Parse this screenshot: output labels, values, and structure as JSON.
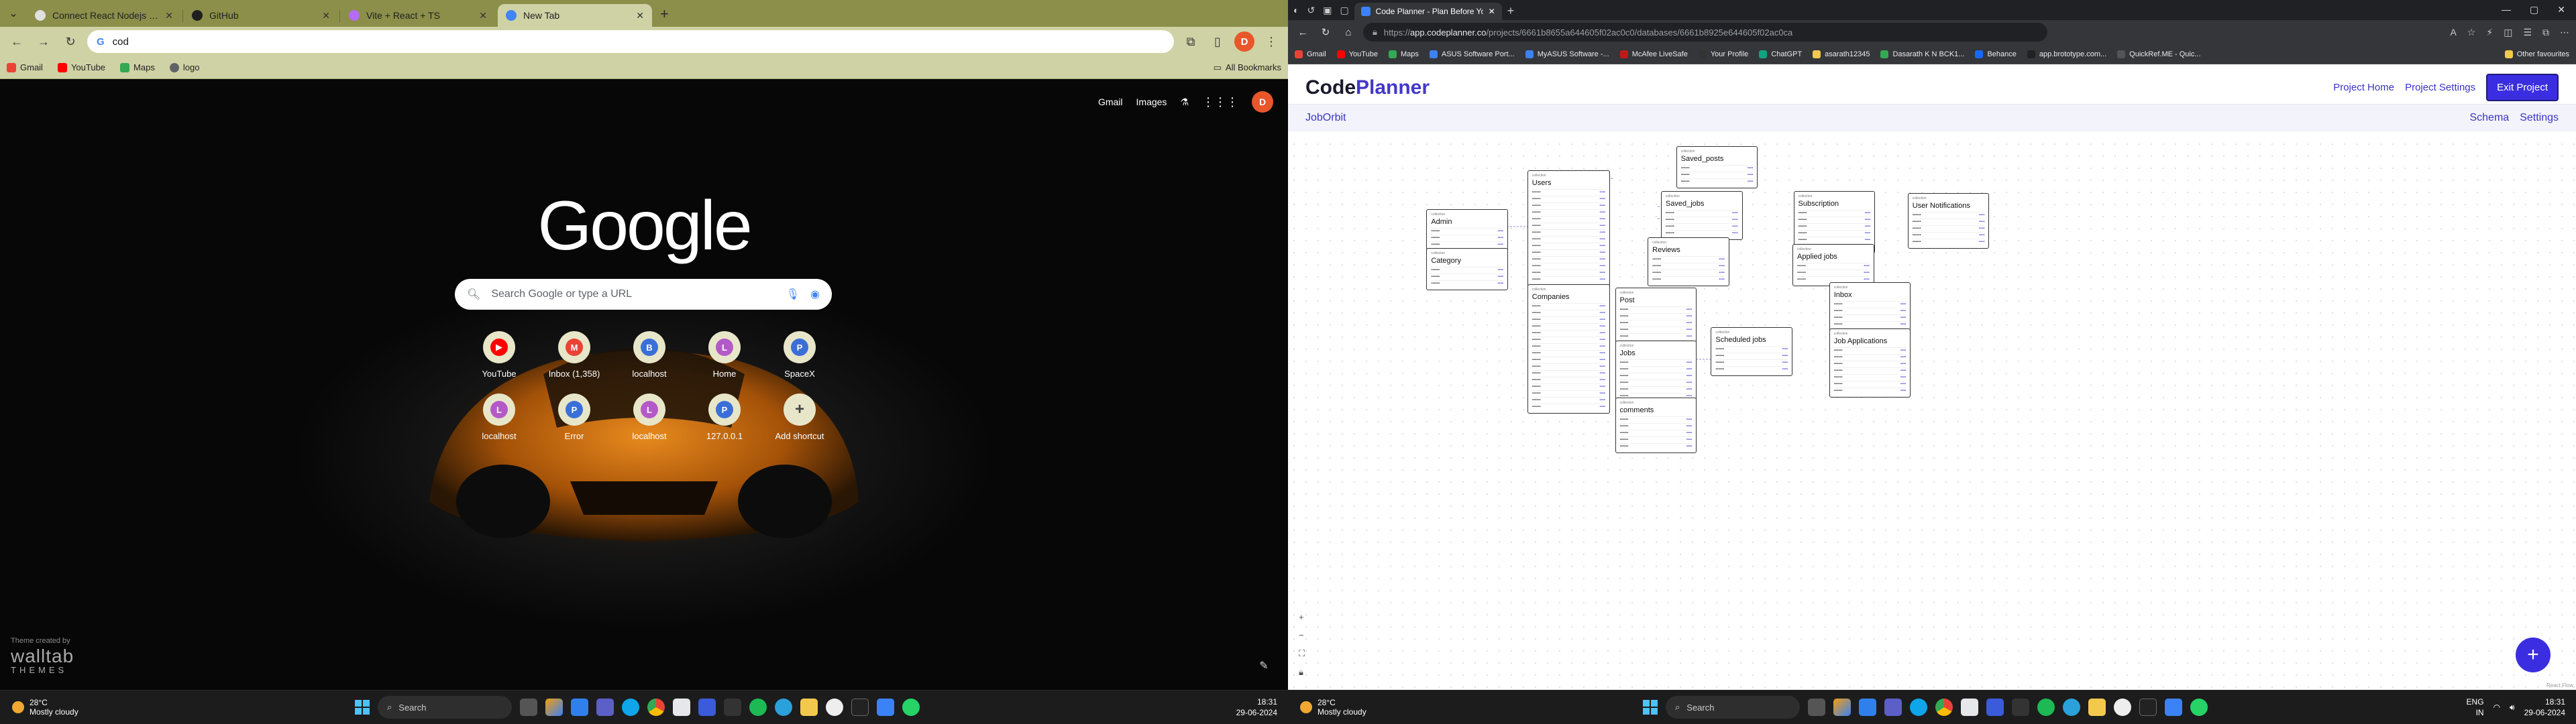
{
  "left": {
    "tabs": [
      {
        "label": "Connect React Nodejs Project",
        "fav_color": "#e0e0e0",
        "active": false
      },
      {
        "label": "GitHub",
        "fav_color": "#1f1f1f",
        "active": false
      },
      {
        "label": "Vite + React + TS",
        "fav_color": "#b56cf7",
        "active": false
      },
      {
        "label": "New Tab",
        "fav_color": "#4285f4",
        "active": true
      }
    ],
    "omnibox_value": "cod",
    "avatar_letter": "D",
    "bookmarks": [
      {
        "label": "Gmail",
        "color": "#ea4335"
      },
      {
        "label": "YouTube",
        "color": "#ff0000"
      },
      {
        "label": "Maps",
        "color": "#34a853"
      },
      {
        "label": "logo",
        "color": "#5f6368"
      }
    ],
    "all_bookmarks": "All Bookmarks",
    "ntp": {
      "links": [
        "Gmail",
        "Images"
      ],
      "logo": "Google",
      "search_placeholder": "Search Google or type a URL",
      "shortcuts": [
        {
          "label": "YouTube",
          "letter": "▶",
          "color": "#ff0000"
        },
        {
          "label": "Inbox (1,358)",
          "letter": "M",
          "color": "#ea4335"
        },
        {
          "label": "localhost",
          "letter": "B",
          "color": "#3b6fd8"
        },
        {
          "label": "Home",
          "letter": "L",
          "color": "#b45ac8"
        },
        {
          "label": "SpaceX",
          "letter": "P",
          "color": "#3b6fd8"
        },
        {
          "label": "localhost",
          "letter": "L",
          "color": "#b45ac8"
        },
        {
          "label": "Error",
          "letter": "P",
          "color": "#3b6fd8"
        },
        {
          "label": "localhost",
          "letter": "L",
          "color": "#b45ac8"
        },
        {
          "label": "127.0.0.1",
          "letter": "P",
          "color": "#3b6fd8"
        },
        {
          "label": "Add shortcut",
          "letter": "+",
          "color": "#e8e6c9"
        }
      ],
      "credit_small": "Theme created by",
      "credit_big": "walltab",
      "credit_themes": "THEMES"
    },
    "taskbar": {
      "temp": "28°C",
      "cond": "Mostly cloudy",
      "search": "Search",
      "time": "18:31",
      "date": "29-06-2024"
    }
  },
  "right": {
    "tab_label": "Code Planner - Plan Before You C",
    "url_prefix": "https://",
    "url_host": "app.codeplanner.co",
    "url_path": "/projects/6661b8655a644605f02ac0c0/databases/6661b8925e644605f02ac0ca",
    "bookmarks": [
      "Gmail",
      "YouTube",
      "Maps",
      "ASUS Software Port...",
      "MyASUS Software -...",
      "McAfee LiveSafe",
      "Your Profile",
      "ChatGPT",
      "asarath12345",
      "Dasarath K N BCK1...",
      "Behance",
      "app.brototype.com...",
      "QuickRef.ME - Quic..."
    ],
    "other_favourites": "Other favourites",
    "app": {
      "logo_a": "Code",
      "logo_b": "Planner",
      "nav": [
        "Project Home",
        "Project Settings"
      ],
      "exit": "Exit Project",
      "project": "JobOrbit",
      "subnav": [
        "Schema",
        "Settings"
      ]
    },
    "taskbar": {
      "temp": "28°C",
      "cond": "Mostly cloudy",
      "search": "Search",
      "lang1": "ENG",
      "lang2": "IN",
      "time": "18:31",
      "date": "29-06-2024"
    }
  }
}
